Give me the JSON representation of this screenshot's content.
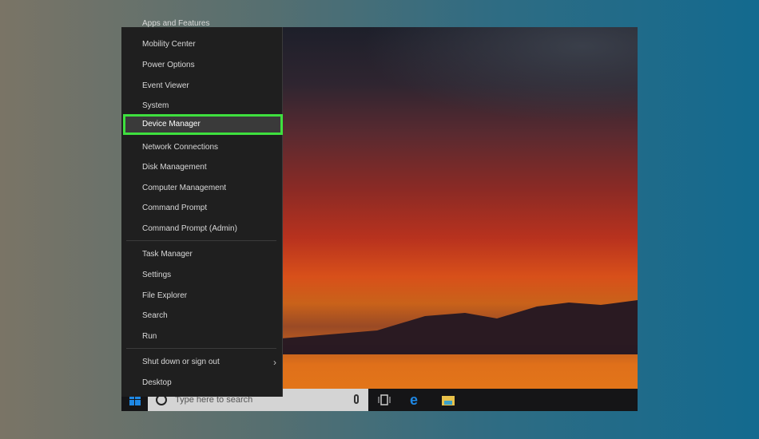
{
  "menu": {
    "items": [
      {
        "label": "Apps and Features"
      },
      {
        "label": "Mobility Center"
      },
      {
        "label": "Power Options"
      },
      {
        "label": "Event Viewer"
      },
      {
        "label": "System"
      },
      {
        "label": "Device Manager",
        "highlighted": true
      },
      {
        "label": "Network Connections"
      },
      {
        "label": "Disk Management"
      },
      {
        "label": "Computer Management"
      },
      {
        "label": "Command Prompt"
      },
      {
        "label": "Command Prompt (Admin)"
      },
      {
        "label": "Task Manager"
      },
      {
        "label": "Settings"
      },
      {
        "label": "File Explorer"
      },
      {
        "label": "Search"
      },
      {
        "label": "Run"
      },
      {
        "label": "Shut down or sign out",
        "submenu": true
      },
      {
        "label": "Desktop"
      }
    ]
  },
  "taskbar": {
    "search_placeholder": "Type here to search",
    "icons": [
      "windows-start-icon",
      "cortana-icon",
      "microphone-icon",
      "task-view-icon",
      "edge-icon",
      "file-explorer-icon"
    ]
  },
  "colors": {
    "highlight": "#3ee03e",
    "menu_bg": "#1f1f1f",
    "accent": "#1e88e5"
  }
}
